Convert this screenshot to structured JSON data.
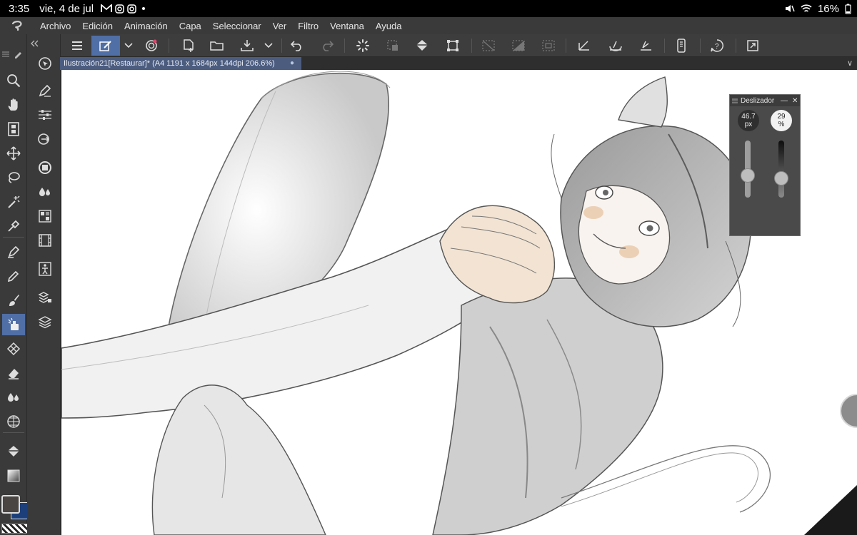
{
  "statusbar": {
    "time": "3:35",
    "date": "vie, 4 de jul",
    "notification_icons": [
      "gmail-icon",
      "instagram-icon",
      "instagram-icon"
    ],
    "battery": "16%"
  },
  "menubar": {
    "items": [
      "Archivo",
      "Edición",
      "Animación",
      "Capa",
      "Seleccionar",
      "Ver",
      "Filtro",
      "Ventana",
      "Ayuda"
    ]
  },
  "document": {
    "tab_label": "Ilustración21[Restaurar]* (A4 1191 x 1684px 144dpi 206.6%)"
  },
  "slider_panel": {
    "title": "Deslizador",
    "brush_size_value": "46.7",
    "brush_size_unit": "px",
    "opacity_value": "29",
    "opacity_unit": "%",
    "brush_size_level": 0.35,
    "opacity_level": 0.29
  },
  "colors": {
    "accent": "#4f6fa6",
    "main_color": "#4a4542",
    "sub_color": "#1c3f7a"
  }
}
